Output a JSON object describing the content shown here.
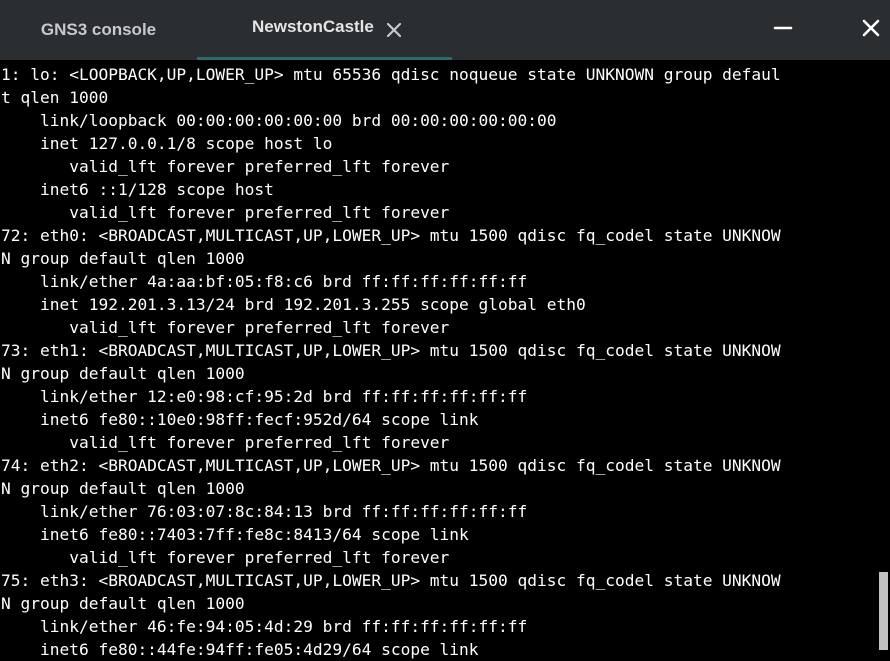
{
  "tabs": {
    "console_label": "GNS3 console",
    "device_label": "NewstonCastle"
  },
  "colors": {
    "titlebar": "#2b2e31",
    "active_tab_underline": "#2d6b6a",
    "terminal_bg": "#000000",
    "terminal_fg": "#ffffff"
  },
  "icons": {
    "tab_close": "close-icon",
    "minimize": "minimize-icon",
    "close": "close-icon"
  },
  "terminal": {
    "lines": [
      "1: lo: <LOOPBACK,UP,LOWER_UP> mtu 65536 qdisc noqueue state UNKNOWN group defaul",
      "t qlen 1000",
      "    link/loopback 00:00:00:00:00:00 brd 00:00:00:00:00:00",
      "    inet 127.0.0.1/8 scope host lo",
      "       valid_lft forever preferred_lft forever",
      "    inet6 ::1/128 scope host",
      "       valid_lft forever preferred_lft forever",
      "72: eth0: <BROADCAST,MULTICAST,UP,LOWER_UP> mtu 1500 qdisc fq_codel state UNKNOW",
      "N group default qlen 1000",
      "    link/ether 4a:aa:bf:05:f8:c6 brd ff:ff:ff:ff:ff:ff",
      "    inet 192.201.3.13/24 brd 192.201.3.255 scope global eth0",
      "       valid_lft forever preferred_lft forever",
      "73: eth1: <BROADCAST,MULTICAST,UP,LOWER_UP> mtu 1500 qdisc fq_codel state UNKNOW",
      "N group default qlen 1000",
      "    link/ether 12:e0:98:cf:95:2d brd ff:ff:ff:ff:ff:ff",
      "    inet6 fe80::10e0:98ff:fecf:952d/64 scope link",
      "       valid_lft forever preferred_lft forever",
      "74: eth2: <BROADCAST,MULTICAST,UP,LOWER_UP> mtu 1500 qdisc fq_codel state UNKNOW",
      "N group default qlen 1000",
      "    link/ether 76:03:07:8c:84:13 brd ff:ff:ff:ff:ff:ff",
      "    inet6 fe80::7403:7ff:fe8c:8413/64 scope link",
      "       valid_lft forever preferred_lft forever",
      "75: eth3: <BROADCAST,MULTICAST,UP,LOWER_UP> mtu 1500 qdisc fq_codel state UNKNOW",
      "N group default qlen 1000",
      "    link/ether 46:fe:94:05:4d:29 brd ff:ff:ff:ff:ff:ff",
      "    inet6 fe80::44fe:94ff:fe05:4d29/64 scope link"
    ]
  }
}
